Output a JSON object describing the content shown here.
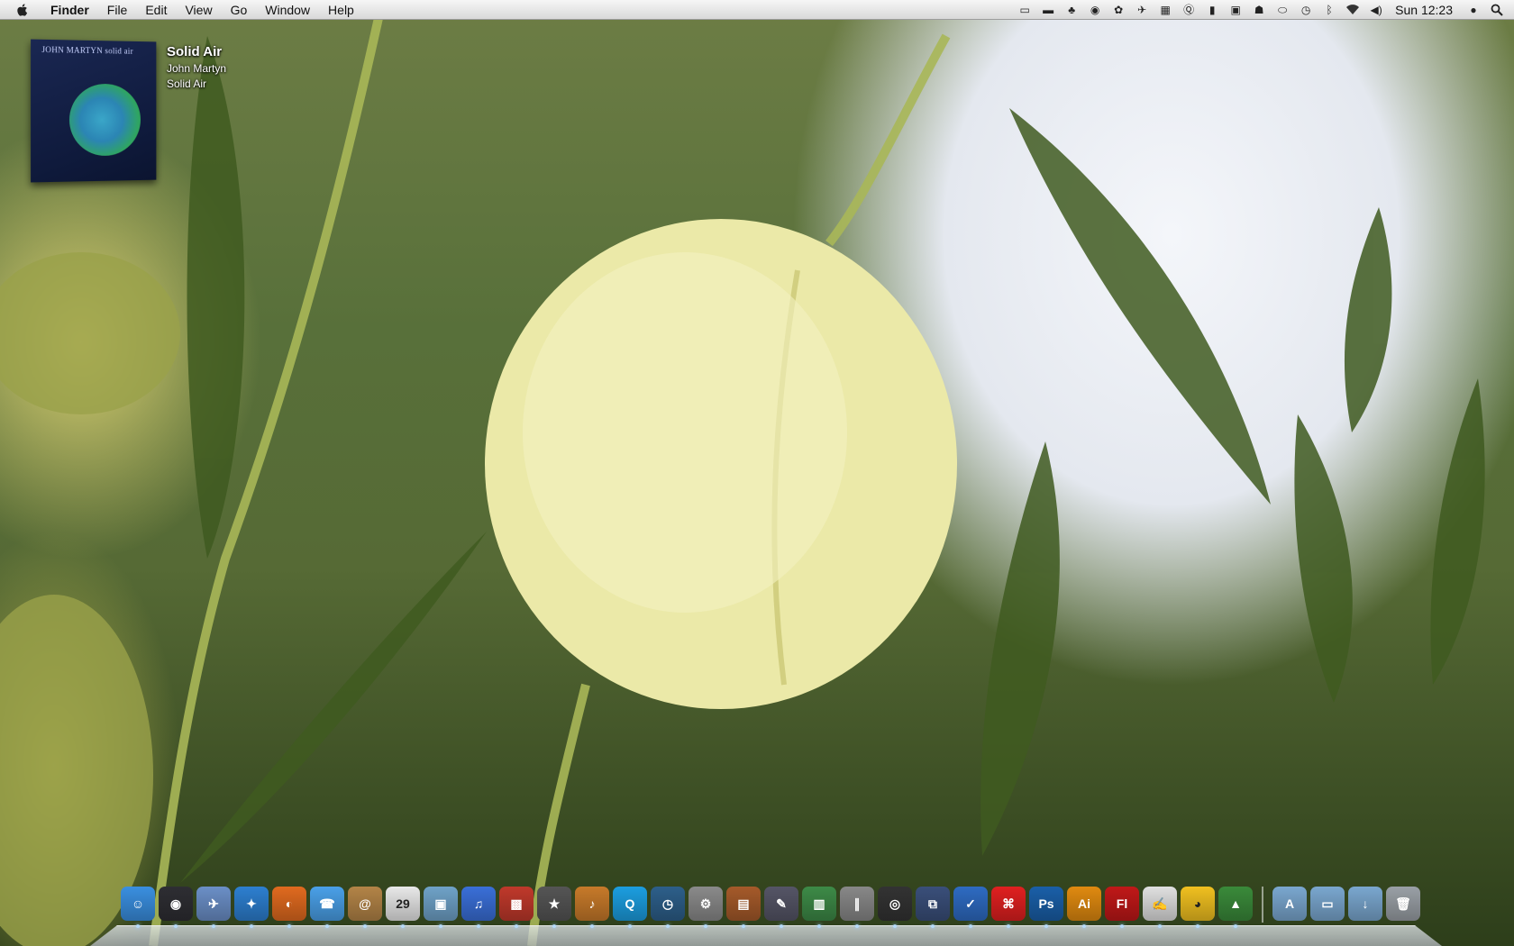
{
  "menubar": {
    "app_name": "Finder",
    "menus": [
      "File",
      "Edit",
      "View",
      "Go",
      "Window",
      "Help"
    ],
    "clock": "Sun 12:23",
    "status_icons": [
      "display-icon",
      "monitor-icon",
      "growl-icon",
      "time-machine-icon",
      "fan-icon",
      "twitter-bird-icon",
      "activity-icon",
      "q-icon",
      "chat-icon",
      "screen-share-icon",
      "evernote-icon",
      "disk-icon",
      "time-machine-clock-icon",
      "bluetooth-icon",
      "wifi-icon",
      "volume-icon"
    ]
  },
  "now_playing": {
    "title": "Solid Air",
    "artist": "John Martyn",
    "album": "Solid Air",
    "cover_text": "JOHN MARTYN  solid air"
  },
  "dock": {
    "apps": [
      {
        "name": "finder",
        "glyph": "☺",
        "color": "#3a8fe0"
      },
      {
        "name": "dashboard",
        "glyph": "◉",
        "color": "#2e2e33"
      },
      {
        "name": "mail-stamp",
        "glyph": "✈",
        "color": "#6b8fc7"
      },
      {
        "name": "safari",
        "glyph": "✦",
        "color": "#2d7fd0"
      },
      {
        "name": "firefox",
        "glyph": "◐",
        "color": "#e06a1f"
      },
      {
        "name": "ichat",
        "glyph": "☎",
        "color": "#4aa0e8"
      },
      {
        "name": "address-book",
        "glyph": "@",
        "color": "#b38447"
      },
      {
        "name": "ical",
        "glyph": "29",
        "color": "#e8e8e8"
      },
      {
        "name": "iphoto",
        "glyph": "▣",
        "color": "#6fa2c8"
      },
      {
        "name": "itunes",
        "glyph": "♫",
        "color": "#3a6fd8"
      },
      {
        "name": "photo-booth",
        "glyph": "▩",
        "color": "#c0392b"
      },
      {
        "name": "imovie",
        "glyph": "★",
        "color": "#555"
      },
      {
        "name": "garageband",
        "glyph": "♪",
        "color": "#c77a2a"
      },
      {
        "name": "quicktime",
        "glyph": "Q",
        "color": "#1c9ee0"
      },
      {
        "name": "time-machine",
        "glyph": "◷",
        "color": "#2d5f8a"
      },
      {
        "name": "system-preferences",
        "glyph": "⚙",
        "color": "#8a8a8a"
      },
      {
        "name": "keynote",
        "glyph": "▤",
        "color": "#a55a2a"
      },
      {
        "name": "script-editor",
        "glyph": "✎",
        "color": "#556"
      },
      {
        "name": "numbers",
        "glyph": "▥",
        "color": "#3d8a47"
      },
      {
        "name": "parallels",
        "glyph": "∥",
        "color": "#888"
      },
      {
        "name": "aperture",
        "glyph": "◎",
        "color": "#333"
      },
      {
        "name": "coda",
        "glyph": "⧉",
        "color": "#3a4f7a"
      },
      {
        "name": "things",
        "glyph": "✓",
        "color": "#2e6bc2"
      },
      {
        "name": "acrobat",
        "glyph": "⌘",
        "color": "#e02020"
      },
      {
        "name": "photoshop",
        "glyph": "Ps",
        "color": "#1a5fa8"
      },
      {
        "name": "illustrator",
        "glyph": "Ai",
        "color": "#e08a10"
      },
      {
        "name": "flash",
        "glyph": "Fl",
        "color": "#c01818"
      },
      {
        "name": "textedit",
        "glyph": "✍",
        "color": "#e0e0e0"
      },
      {
        "name": "cyberduck",
        "glyph": "◕",
        "color": "#f0c020"
      },
      {
        "name": "camino",
        "glyph": "▲",
        "color": "#3a8a3a"
      }
    ],
    "stacks": [
      {
        "name": "applications-stack",
        "glyph": "A",
        "color": "#7aa7cf"
      },
      {
        "name": "documents-stack",
        "glyph": "▭",
        "color": "#7aa7cf"
      },
      {
        "name": "downloads-stack",
        "glyph": "↓",
        "color": "#7aa7cf"
      },
      {
        "name": "trash",
        "glyph": "🗑",
        "color": "#9aa0a6"
      }
    ]
  }
}
